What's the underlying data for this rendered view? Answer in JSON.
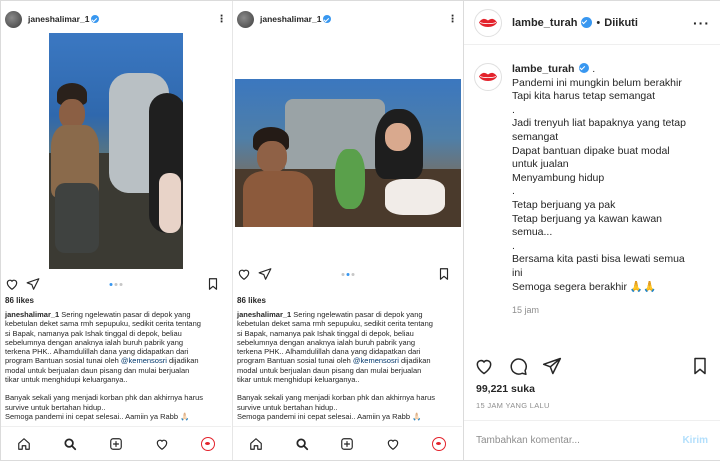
{
  "left_post": {
    "username": "janeshalimar_1",
    "likes": "86 likes",
    "caption_lines": [
      "Sering ngelewatin pasar di depok yang",
      "kebetulan deket sama rmh sepupuku, sedikit cerita tentang",
      "si Bapak, namanya pak Ishak tinggal di depok, beliau",
      "sebelumnya dengan anaknya ialah buruh pabrik yang",
      "terkena PHK.. Alhamdulillah dana yang didapatkan dari",
      "program Bantuan sosial tunai oleh",
      "modal untuk berjualan daun pisang dan mulai berjualan",
      "tikar untuk menghidupi keluarganya.."
    ],
    "mention": "@kemensosri",
    "mention_suffix": " dijadikan",
    "caption_lines_2": [
      "Banyak sekali yang menjadi korban phk dan akhirnya harus",
      "survive untuk bertahan hidup..",
      "Semoga pandemi ini cepat selesai.. Aamiin ya Rabb 🙏🏻"
    ]
  },
  "middle_post": {
    "username": "janeshalimar_1",
    "likes": "86 likes",
    "caption_lines": [
      "Sering ngelewatin pasar di depok yang",
      "kebetulan deket sama rmh sepupuku, sedikit cerita tentang",
      "si Bapak, namanya pak Ishak tinggal di depok, beliau",
      "sebelumnya dengan anaknya ialah buruh pabrik yang",
      "terkena PHK.. Alhamdulillah dana yang didapatkan dari",
      "program Bantuan sosial tunai oleh",
      "modal untuk berjualan daun pisang dan mulai berjualan",
      "tikar untuk menghidupi keluarganya.."
    ],
    "mention": "@kemensosri",
    "mention_suffix": " dijadikan",
    "caption_lines_2": [
      "Banyak sekali yang menjadi korban phk dan akhirnya harus",
      "survive untuk bertahan hidup..",
      "Semoga pandemi ini cepat selesai.. Aamiin ya Rabb 🙏🏻"
    ]
  },
  "right_post": {
    "username": "lambe_turah",
    "separator": "•",
    "follow_status": "Diikuti",
    "caption": [
      "Pandemi ini mungkin belum berakhir",
      "Tapi kita harus tetap semangat",
      ".",
      "Jadi trenyuh liat bapaknya yang tetap",
      "semangat",
      "Dapat bantuan dipake buat modal",
      "untuk jualan",
      "Menyambung hidup",
      ".",
      "Tetap berjuang ya pak",
      "Tetap berjuang ya kawan kawan",
      "semua...",
      ".",
      "Bersama kita pasti bisa lewati semua",
      "ini",
      "Semoga segera berakhir 🙏🙏"
    ],
    "time": "15 jam",
    "likes": "99,221 suka",
    "date": "15 JAM YANG LALU",
    "comment_placeholder": "Tambahkan komentar...",
    "post_label": "Kirim"
  },
  "colors": {
    "verified": "#3897f0",
    "brand_red": "#e3222b",
    "post_disabled": "#b2dffc"
  }
}
